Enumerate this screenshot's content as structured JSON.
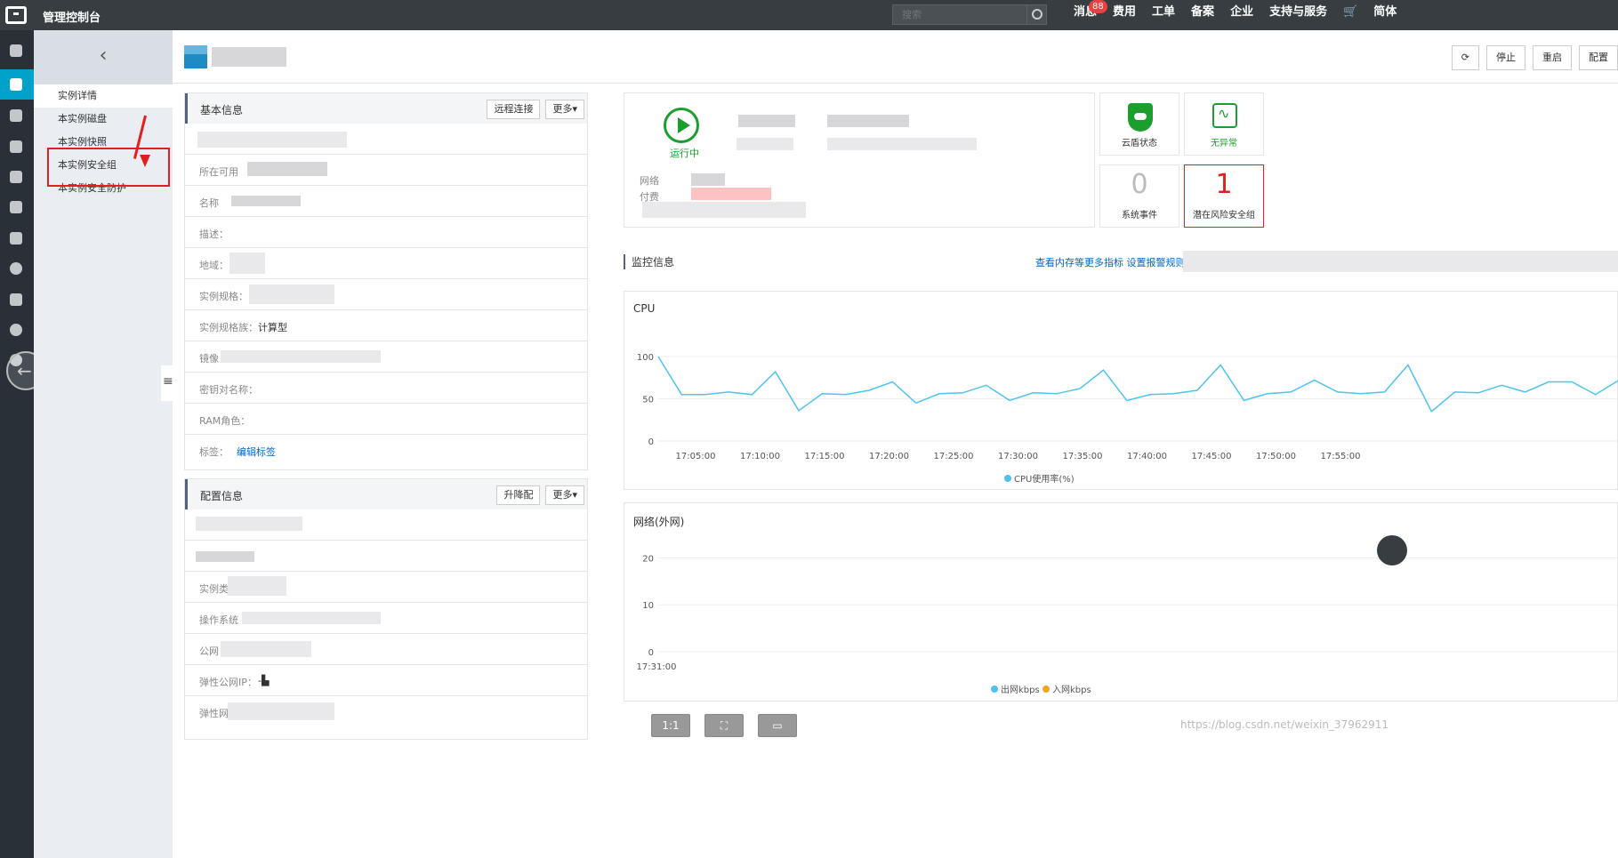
{
  "topbar": {
    "title": "管理控制台",
    "search_placeholder": "搜索",
    "nav": [
      "消息",
      "费用",
      "工单",
      "备案",
      "企业",
      "支持与服务",
      "简体"
    ],
    "message_badge": "88"
  },
  "subnav": {
    "items": [
      "实例详情",
      "本实例磁盘",
      "本实例快照",
      "本实例安全组",
      "本实例安全防护"
    ]
  },
  "header": {
    "buttons": [
      "停止",
      "重启",
      "配置"
    ]
  },
  "basic_info": {
    "title": "基本信息",
    "buttons": [
      "远程连接",
      "更多▾"
    ],
    "rows": {
      "zone": "所在可用",
      "name": "名称",
      "desc": "描述：",
      "region": "地域：",
      "spec": "实例规格：",
      "spec_family": "实例规格族：",
      "spec_family_value": "计算型",
      "image": "镜像",
      "keypair": "密钥对名称：",
      "ram": "RAM角色：",
      "tags": "标签：",
      "tags_link": "编辑标签"
    }
  },
  "config_info": {
    "title": "配置信息",
    "buttons": [
      "升降配",
      "更多▾"
    ],
    "rows": {
      "type": "实例类",
      "os": "操作系统",
      "public": "公网",
      "eip": "弹性公网IP：",
      "eni": "弹性网"
    }
  },
  "status": {
    "state": "运行中",
    "net_label": "网络",
    "pay_label": "付费"
  },
  "tiles": {
    "cloud_shield": "云盾状态",
    "no_exception": "无异常",
    "sys_events_count": "0",
    "sys_events": "系统事件",
    "risk_sg_count": "1",
    "risk_sg": "潜在风险安全组"
  },
  "monitor": {
    "title": "监控信息",
    "links": "查看内存等更多指标  设置报警规则"
  },
  "colors": {
    "accent": "#00a2ca",
    "cpu_line": "#4ec3f0",
    "in_legend": "#f4a623",
    "success": "#1a9e2e",
    "danger": "#e02020"
  },
  "chart_data": [
    {
      "type": "line",
      "title": "CPU",
      "x": [
        "17:05:00",
        "17:10:00",
        "17:15:00",
        "17:20:00",
        "17:25:00",
        "17:30:00",
        "17:35:00",
        "17:40:00",
        "17:45:00",
        "17:50:00",
        "17:55:00"
      ],
      "yticks": [
        0,
        50,
        100
      ],
      "ylim": [
        0,
        100
      ],
      "series": [
        {
          "name": "CPU使用率(%)",
          "values": [
            100,
            55,
            55,
            58,
            55,
            82,
            36,
            56,
            55,
            60,
            70,
            45,
            56,
            57,
            66,
            48,
            57,
            56,
            62,
            84,
            48,
            55,
            56,
            60,
            90,
            48,
            56,
            58,
            72,
            58,
            56,
            58,
            90,
            35,
            58,
            57,
            66,
            58,
            70,
            70,
            55,
            72
          ]
        }
      ]
    },
    {
      "type": "line",
      "title": "网络(外网)",
      "x": [
        "17:31:00"
      ],
      "yticks": [
        0,
        10,
        20
      ],
      "ylim": [
        0,
        25
      ],
      "series": [
        {
          "name": "出网kbps",
          "values": []
        },
        {
          "name": "入网kbps",
          "values": []
        }
      ]
    }
  ],
  "tools": [
    "1:1"
  ],
  "watermark": "https://blog.csdn.net/weixin_37962911"
}
